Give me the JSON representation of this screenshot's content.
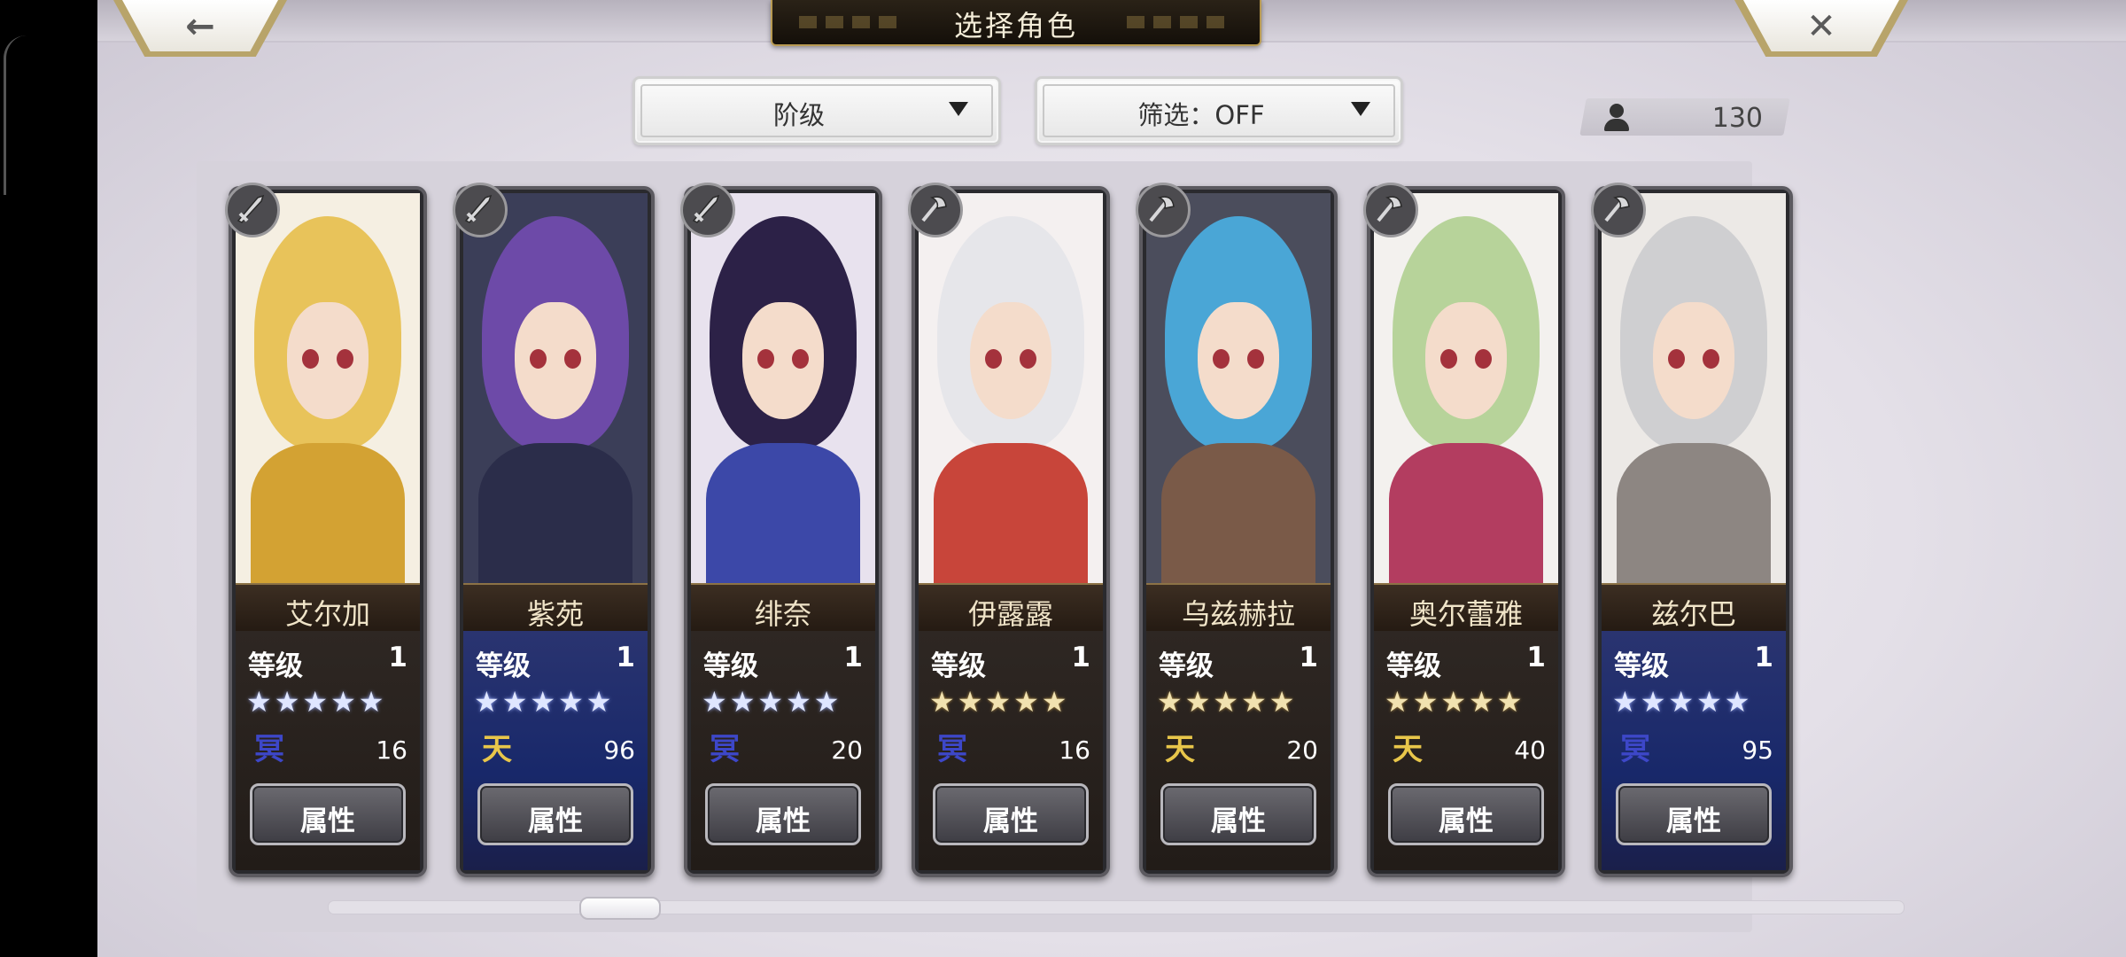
{
  "title": "选择角色",
  "nav": {
    "back_glyph": "←",
    "close_glyph": "✕"
  },
  "dropdowns": {
    "rank": {
      "label": "阶级"
    },
    "filter": {
      "label": "筛选：OFF"
    }
  },
  "character_count": "130",
  "characters": [
    {
      "name": "艾尔加",
      "level_label": "等级",
      "level": "1",
      "stars": 5,
      "star_color": "silver",
      "element": "冥",
      "points": "16",
      "attr_label": "属性",
      "panel": "dark",
      "hair": "#e8c35a",
      "body": "#d3a233",
      "bg": "#f5efe2"
    },
    {
      "name": "紫苑",
      "level_label": "等级",
      "level": "1",
      "stars": 5,
      "star_color": "silver",
      "element": "天",
      "points": "96",
      "attr_label": "属性",
      "panel": "blue",
      "hair": "#6d4aa8",
      "body": "#2b2d4a",
      "bg": "#3b3e58"
    },
    {
      "name": "绯奈",
      "level_label": "等级",
      "level": "1",
      "stars": 5,
      "star_color": "silver",
      "element": "冥",
      "points": "20",
      "attr_label": "属性",
      "panel": "dark",
      "hair": "#2c2147",
      "body": "#3c48a8",
      "bg": "#e8e2ee"
    },
    {
      "name": "伊露露",
      "level_label": "等级",
      "level": "1",
      "stars": 5,
      "star_color": "gold",
      "element": "冥",
      "points": "16",
      "attr_label": "属性",
      "panel": "dark",
      "hair": "#e6e6ea",
      "body": "#c8453a",
      "bg": "#f4f0f0"
    },
    {
      "name": "乌兹赫拉",
      "level_label": "等级",
      "level": "1",
      "stars": 5,
      "star_color": "gold",
      "element": "天",
      "points": "20",
      "attr_label": "属性",
      "panel": "dark",
      "hair": "#4aa6d6",
      "body": "#7a5a48",
      "bg": "#4b4d5c"
    },
    {
      "name": "奥尔蕾雅",
      "level_label": "等级",
      "level": "1",
      "stars": 5,
      "star_color": "gold",
      "element": "天",
      "points": "40",
      "attr_label": "属性",
      "panel": "dark",
      "hair": "#b7d39a",
      "body": "#b33d60",
      "bg": "#f3f1ee"
    },
    {
      "name": "兹尔巴",
      "level_label": "等级",
      "level": "1",
      "stars": 5,
      "star_color": "silver",
      "element": "冥",
      "points": "95",
      "attr_label": "属性",
      "panel": "blue",
      "hair": "#cfcfd1",
      "body": "#8d8682",
      "bg": "#ece9e6"
    }
  ],
  "colors": {
    "accent_gold": "#b89a52",
    "ming": "#3d47c8",
    "tian": "#e8c64a"
  },
  "icons": {
    "weapon_sword": "sword-icon",
    "weapon_axe": "axe-icon",
    "user": "user-icon"
  },
  "scroll_position": 0.14
}
